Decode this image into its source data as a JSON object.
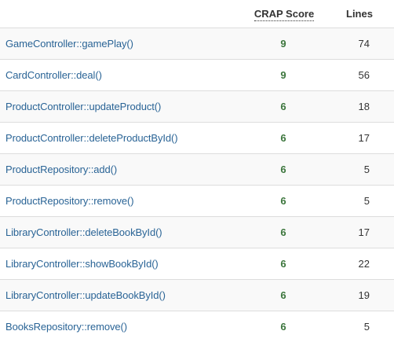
{
  "table": {
    "headers": {
      "method": "",
      "crap_score": "CRAP Score",
      "lines": "Lines"
    },
    "rows": [
      {
        "method": "GameController::gamePlay()",
        "crap": "9",
        "lines": "74"
      },
      {
        "method": "CardController::deal()",
        "crap": "9",
        "lines": "56"
      },
      {
        "method": "ProductController::updateProduct()",
        "crap": "6",
        "lines": "18"
      },
      {
        "method": "ProductController::deleteProductById()",
        "crap": "6",
        "lines": "17"
      },
      {
        "method": "ProductRepository::add()",
        "crap": "6",
        "lines": "5"
      },
      {
        "method": "ProductRepository::remove()",
        "crap": "6",
        "lines": "5"
      },
      {
        "method": "LibraryController::deleteBookById()",
        "crap": "6",
        "lines": "17"
      },
      {
        "method": "LibraryController::showBookById()",
        "crap": "6",
        "lines": "22"
      },
      {
        "method": "LibraryController::updateBookById()",
        "crap": "6",
        "lines": "19"
      },
      {
        "method": "BooksRepository::remove()",
        "crap": "6",
        "lines": "5"
      }
    ]
  },
  "colors": {
    "link": "#2a6496",
    "crap_score": "#3c763d",
    "row_stripe": "#f9f9f9",
    "border": "#dddddd"
  }
}
